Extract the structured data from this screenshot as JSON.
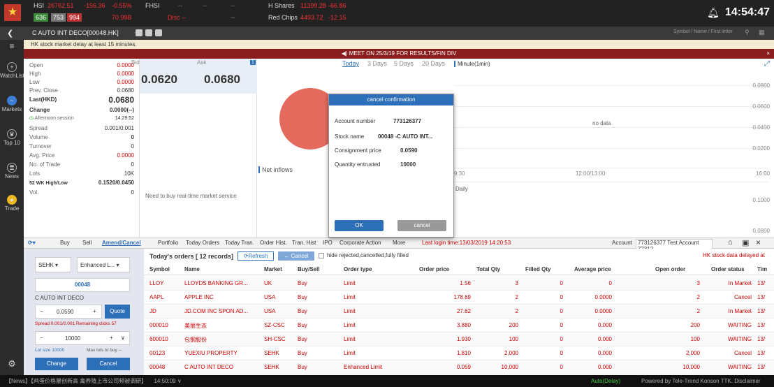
{
  "top": {
    "hsi_label": "HSI",
    "hsi_value": "26762.51",
    "hsi_change": "-156.36",
    "hsi_pct": "-0.55%",
    "hsi_b1": "636",
    "hsi_b2": "753",
    "hsi_b3": "994",
    "hsi_turnover": "70.99B",
    "fhsi_label": "FHSI",
    "fhsi_value": "--",
    "fhsi_change": "--",
    "fhsi_disc": "Disc --",
    "dash1": "--",
    "dash2": "--",
    "hshares_label": "H Shares",
    "hshares_value": "11399.28",
    "hshares_change": "-66.86",
    "redchips_label": "Red Chips",
    "redchips_value": "4493.72",
    "redchips_change": "-12.15",
    "time": "14:54:47"
  },
  "sub": {
    "title": "C AUTO INT DECO[00048.HK]",
    "search_placeholder": "Symbol / Name / First letter"
  },
  "delay_notice": "HK stock market delay at least 15 minutes.",
  "meet_notice": "MEET ON 25/3/19 FOR RESULTS/FIN DIV",
  "nav": {
    "watchlist": "WatchList",
    "markets": "Markets",
    "top10": "Top 10",
    "news": "News",
    "trade": "Trade"
  },
  "quote": {
    "open": "Open",
    "open_v": "0.0000",
    "high": "High",
    "high_v": "0.0000",
    "low": "Low",
    "low_v": "0.0000",
    "prevclose": "Prev. Close",
    "prevclose_v": "0.0680",
    "last": "Last(HKD)",
    "last_v": "0.0680",
    "change": "Change",
    "change_v": "0.0000(--)",
    "session": "Afternoon session",
    "session_v": "14:29:52",
    "spread": "Spread",
    "spread_v": "0.001/0.001",
    "volume": "Volume",
    "volume_v": "0",
    "turnover": "Turnover",
    "turnover_v": "0",
    "avg": "Avg. Price",
    "avg_v": "0.0000",
    "trades": "No. of Trade",
    "trades_v": "0",
    "lots": "Lots",
    "lots_v": "10K",
    "wk52": "52 WK High/Low",
    "wk52_v": "0.1520/0.0450",
    "vol": "Vol.",
    "vol_v": "0"
  },
  "bidask": {
    "bid_label": "Bid",
    "ask_label": "Ask",
    "bid": "0.0620",
    "ask": "0.0680",
    "badge": "1",
    "service_msg": "Need to buy real-time market service"
  },
  "chart": {
    "tabs": [
      "Today",
      "3 Days",
      "5 Days",
      "20 Days"
    ],
    "minute": "Minute(1min)",
    "net_inflows": "Net inflows",
    "no_data": "no data",
    "y_ticks": [
      "0.0800",
      "0.0600",
      "0.0400",
      "0.0200"
    ],
    "x_ticks": [
      "9:30",
      "12:00/13:00",
      "16:00"
    ],
    "daily": "Daily",
    "daily_ticks": [
      "0.1000",
      "0.0800"
    ]
  },
  "dialog": {
    "title": "cancel confirmation",
    "account_label": "Account number",
    "account_value": "773126377",
    "stock_label": "Stock name",
    "stock_value": "00048 -C AUTO INT...",
    "price_label": "Consignment price",
    "price_value": "0.0590",
    "qty_label": "Quantity entrusted",
    "qty_value": "10000",
    "ok": "OK",
    "cancel": "cancel"
  },
  "tabs": {
    "buy": "Buy",
    "sell": "Sell",
    "amend": "Amend/Cancel",
    "portfolio": "Portfolio",
    "today_orders": "Today Orders",
    "today_tran": "Today Tran.",
    "order_hist": "Order Hist.",
    "tran_hist": "Tran. Hist",
    "ipo": "IPO",
    "corp": "Corporate Action",
    "more": "More",
    "last_login": "Last login time:13/03/2019 14:20:53",
    "account_label": "Account",
    "account_value": "773126377 Test Account 77312"
  },
  "form": {
    "market": "SEHK",
    "order_type": "Enhanced L...",
    "symbol": "00048",
    "name": "C AUTO INT DECO",
    "price": "0.0590",
    "quote_btn": "Quote",
    "spread_info": "Spread 0.001/0.001  Remaining clicks 57",
    "qty": "10000",
    "lot_size": "Lot size 10000",
    "max_lots": "Max lots to buy --",
    "change_btn": "Change",
    "cancel_btn": "Cancel"
  },
  "orders": {
    "title": "Today's orders [ 12 records]",
    "refresh": "Refresh",
    "cancel_btn": "Cancel",
    "hide_label": "hide rejected,cancelled,fully filled",
    "delay_note": "HK stock data delayed at",
    "headers": [
      "Symbol",
      "Name",
      "Market",
      "Buy/Sell",
      "Order type",
      "Order price",
      "Total Qty",
      "Filled Qty",
      "Average price",
      "Open order",
      "Order status",
      "Tim"
    ],
    "rows": [
      {
        "symbol": "LLOY",
        "name": "LLOYDS BANKING GR...",
        "market": "UK",
        "side": "Buy",
        "type": "Limit",
        "price": "1.56",
        "qty": "3",
        "filled": "0",
        "avg": "0",
        "open": "3",
        "status": "In Market",
        "time": "13/"
      },
      {
        "symbol": "AAPL",
        "name": "APPLE INC",
        "market": "USA",
        "side": "Buy",
        "type": "Limit",
        "price": "178.69",
        "qty": "2",
        "filled": "0",
        "avg": "0.0000",
        "open": "2",
        "status": "Cancel",
        "time": "13/"
      },
      {
        "symbol": "JD",
        "name": "JD.COM INC SPON AD...",
        "market": "USA",
        "side": "Buy",
        "type": "Limit",
        "price": "27.62",
        "qty": "2",
        "filled": "0",
        "avg": "0.0000",
        "open": "2",
        "status": "In Market",
        "time": "13/"
      },
      {
        "symbol": "000010",
        "name": "美丽生态",
        "market": "SZ-CSC",
        "side": "Buy",
        "type": "Limit",
        "price": "3.880",
        "qty": "200",
        "filled": "0",
        "avg": "0.000",
        "open": "200",
        "status": "WAITING",
        "time": "13/"
      },
      {
        "symbol": "600010",
        "name": "包钢股份",
        "market": "SH-CSC",
        "side": "Buy",
        "type": "Limit",
        "price": "1.930",
        "qty": "100",
        "filled": "0",
        "avg": "0.000",
        "open": "100",
        "status": "WAITING",
        "time": "13/"
      },
      {
        "symbol": "00123",
        "name": "YUEXIU PROPERTY",
        "market": "SEHK",
        "side": "Buy",
        "type": "Limit",
        "price": "1.810",
        "qty": "2,000",
        "filled": "0",
        "avg": "0.000",
        "open": "2,000",
        "status": "Cancel",
        "time": "13/"
      },
      {
        "symbol": "00048",
        "name": "C AUTO INT DECO",
        "market": "SEHK",
        "side": "Buy",
        "type": "Enhanced Limit",
        "price": "0.059",
        "qty": "10,000",
        "filled": "0",
        "avg": "0.000",
        "open": "10,000",
        "status": "WAITING",
        "time": "13/"
      }
    ]
  },
  "bottom": {
    "news": "【News】【鸡蛋价格屡创新高 禽养殖上市公司频被调研】",
    "news_time": "14:50:09",
    "auto": "Auto(Delay)",
    "powered": "Powered by Tele-Trend Konson   TTK. Disclaimer"
  },
  "colors": {
    "up": "#cc0000",
    "down": "#0a8a0a",
    "accent": "#2d6fb9"
  }
}
